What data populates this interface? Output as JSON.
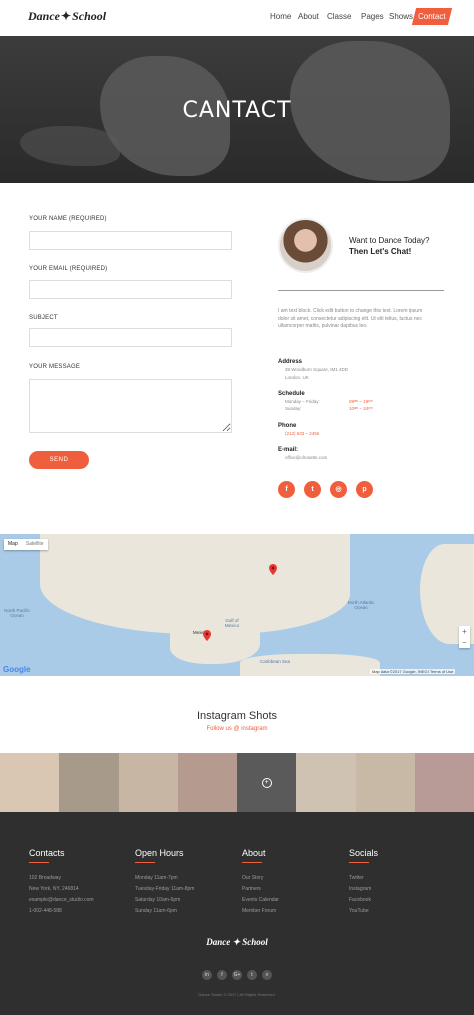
{
  "brand": {
    "logo_left": "Dance",
    "logo_right": "School"
  },
  "nav": {
    "items": [
      "Home",
      "About",
      "Classe",
      "Pages",
      "Shows"
    ],
    "active": "Contact"
  },
  "hero": {
    "title": "CANTACT"
  },
  "form": {
    "name_label": "YOUR NAME (REQUIRED)",
    "email_label": "YOUR EMAIL (REQUIRED)",
    "subject_label": "SUBJECT",
    "message_label": "YOUR MESSAGE",
    "name_value": "",
    "email_value": "",
    "subject_value": "",
    "message_value": "",
    "send_label": "SEND"
  },
  "chat": {
    "line1": "Want to Dance Today?",
    "line2": "Then Let's Chat!"
  },
  "about_text": "I am text block. Click edit button to change this text. Lorem ipsum dolor sit amet, consectetur adipiscing elit. Ut elit tellus, luctus nec ullamcorper mattis, pulvinar dapibus leo.",
  "info": {
    "address_head": "Address",
    "address_line1": "38 Woodburn Square, IM1 4DD",
    "address_line2": "London, UK",
    "schedule_head": "Schedule",
    "schedule_days1": "Monday – Friday:",
    "schedule_hours1": "09ᵃᵐ – 19ᵖᵐ",
    "schedule_days2": "Sunday:",
    "schedule_hours2": "10ᵃᵐ – 24ᵖᵐ",
    "phone_head": "Phone",
    "phone": "(212) 633 – 2455",
    "email_head": "E-mail:",
    "email": "office@olrosette.com"
  },
  "socials_contact": [
    {
      "icon": "facebook-icon",
      "glyph": "f"
    },
    {
      "icon": "twitter-icon",
      "glyph": "t"
    },
    {
      "icon": "instagram-icon",
      "glyph": "◎"
    },
    {
      "icon": "pinterest-icon",
      "glyph": "p"
    }
  ],
  "map": {
    "tab_map": "Map",
    "tab_satellite": "Satellite",
    "label_north_pacific": "North Pacific Ocean",
    "label_north_atlantic": "North Atlantic Ocean",
    "label_gulf": "Gulf of Mexico",
    "label_caribbean": "Caribbean Sea",
    "label_mexico": "Mexico",
    "google": "Google",
    "attribution": "Map data ©2017 Google, INEGI",
    "terms": "Terms of Use",
    "zoom_in": "+",
    "zoom_out": "−"
  },
  "instagram": {
    "title": "Instagram Shots",
    "subtitle": "Follow us @ instagram",
    "overlay": "+"
  },
  "instagram_tiles": [
    "#d9c7b4",
    "#a89a8a",
    "#c7b6a4",
    "#b59a90",
    "#5a5a5a",
    "#cfc2b3",
    "#c8b9a7",
    "#b89a96"
  ],
  "footer": {
    "contacts_head": "Contacts",
    "contacts": [
      "102 Broadway",
      "New York, NY, 246814",
      "example@dance_studio.com",
      "1-002-448-588"
    ],
    "hours_head": "Open Hours",
    "hours": [
      "Monday 11am-7pm",
      "Tuesday-Friday 11am-8pm",
      "Saturday 10am-6pm",
      "Sunday 11am-6pm"
    ],
    "about_head": "About",
    "about": [
      "Our Story",
      "Partners",
      "Events Calendar",
      "Member Forum"
    ],
    "socials_head": "Socials",
    "socials": [
      "Twitter",
      "Instagram",
      "Facebook",
      "YouTube"
    ],
    "logo_left": "Dance",
    "logo_right": "School",
    "social_icons": [
      {
        "icon": "linkedin-icon",
        "glyph": "in"
      },
      {
        "icon": "facebook-icon",
        "glyph": "f"
      },
      {
        "icon": "google-plus-icon",
        "glyph": "G+"
      },
      {
        "icon": "twitter-icon",
        "glyph": "t"
      },
      {
        "icon": "vimeo-icon",
        "glyph": "v"
      }
    ],
    "copyright": "Dance Studio © 2017 | All Rights Reserved."
  },
  "colors": {
    "accent": "#ef5f3d",
    "footer_bg": "#2f2f2f",
    "hero_bg": "#333333",
    "map_water": "#a9cbe7"
  }
}
